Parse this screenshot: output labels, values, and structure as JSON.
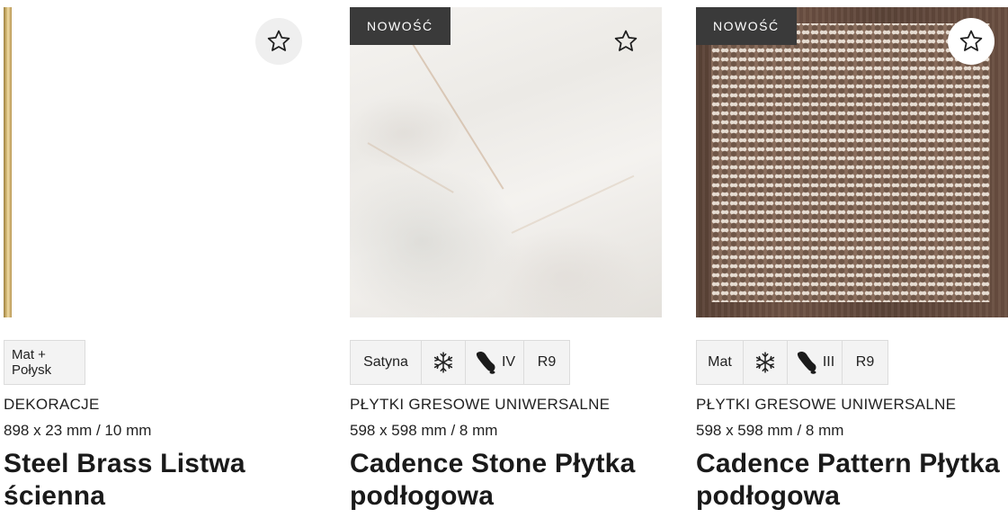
{
  "products": [
    {
      "badge": "",
      "attributes": [
        {
          "text": "Mat +\nPołysk"
        }
      ],
      "category": "DEKORACJE",
      "dimensions": "898 x 23 mm / 10 mm",
      "title": "Steel Brass Listwa ścienna"
    },
    {
      "badge": "NOWOŚĆ",
      "attributes": [
        {
          "text": "Satyna"
        },
        {
          "icon": "snowflake-icon"
        },
        {
          "icon": "footprint-icon",
          "text": "IV"
        },
        {
          "text": "R9"
        }
      ],
      "category": "PŁYTKI GRESOWE UNIWERSALNE",
      "dimensions": "598 x 598 mm / 8 mm",
      "title": "Cadence Stone Płytka podłogowa"
    },
    {
      "badge": "NOWOŚĆ",
      "attributes": [
        {
          "text": "Mat"
        },
        {
          "icon": "snowflake-icon"
        },
        {
          "icon": "footprint-icon",
          "text": "III"
        },
        {
          "text": "R9"
        }
      ],
      "category": "PŁYTKI GRESOWE UNIWERSALNE",
      "dimensions": "598 x 598 mm / 8 mm",
      "title": "Cadence Pattern Płytka podłogowa"
    }
  ]
}
